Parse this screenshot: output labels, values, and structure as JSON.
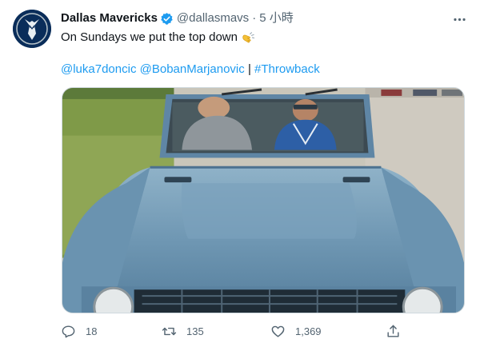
{
  "tweet": {
    "display_name": "Dallas Mavericks",
    "handle": "@dallasmavs",
    "separator": "·",
    "time": "5 小時",
    "text_line1": "On Sundays we put the top down",
    "emoji_icon": "waving-hand-icon",
    "mention1": "@luka7doncic",
    "mention2": "@BobanMarjanovic",
    "divider": "|",
    "hashtag": "#Throwback"
  },
  "actions": {
    "reply_count": "18",
    "retweet_count": "135",
    "like_count": "1,369"
  },
  "colors": {
    "link": "#1d9bf0",
    "secondary_text": "#536471",
    "verified": "#1d9bf0",
    "avatar_bg": "#0a2d5a"
  }
}
